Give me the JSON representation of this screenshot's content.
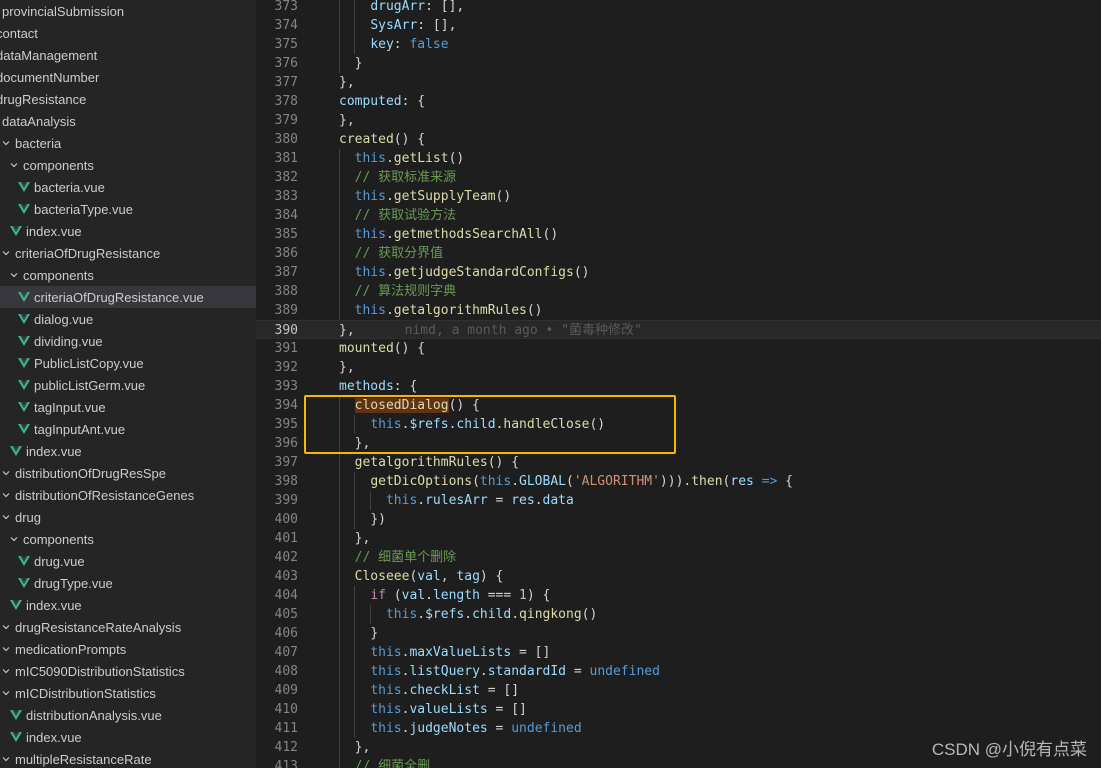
{
  "explorer": {
    "items": [
      {
        "label": "provincialSubmission",
        "level": 0,
        "kind": "folder",
        "chev": false
      },
      {
        "label": "contact",
        "level": -1,
        "kind": "folder",
        "chev": false
      },
      {
        "label": "dataManagement",
        "level": -1,
        "kind": "folder",
        "chev": false
      },
      {
        "label": "documentNumber",
        "level": -1,
        "kind": "folder",
        "chev": false
      },
      {
        "label": "drugResistance",
        "level": -1,
        "kind": "folder",
        "chev": false
      },
      {
        "label": "dataAnalysis",
        "level": 0,
        "kind": "folder",
        "chev": false
      },
      {
        "label": "bacteria",
        "level": 0,
        "kind": "folder",
        "chev": true
      },
      {
        "label": "components",
        "level": 1,
        "kind": "folder",
        "chev": true
      },
      {
        "label": "bacteria.vue",
        "level": 2,
        "kind": "vue"
      },
      {
        "label": "bacteriaType.vue",
        "level": 2,
        "kind": "vue"
      },
      {
        "label": "index.vue",
        "level": 1,
        "kind": "vue"
      },
      {
        "label": "criteriaOfDrugResistance",
        "level": 0,
        "kind": "folder",
        "chev": true
      },
      {
        "label": "components",
        "level": 1,
        "kind": "folder",
        "chev": true
      },
      {
        "label": "criteriaOfDrugResistance.vue",
        "level": 2,
        "kind": "vue",
        "selected": true
      },
      {
        "label": "dialog.vue",
        "level": 2,
        "kind": "vue"
      },
      {
        "label": "dividing.vue",
        "level": 2,
        "kind": "vue"
      },
      {
        "label": "PublicListCopy.vue",
        "level": 2,
        "kind": "vue"
      },
      {
        "label": "publicListGerm.vue",
        "level": 2,
        "kind": "vue"
      },
      {
        "label": "tagInput.vue",
        "level": 2,
        "kind": "vue"
      },
      {
        "label": "tagInputAnt.vue",
        "level": 2,
        "kind": "vue"
      },
      {
        "label": "index.vue",
        "level": 1,
        "kind": "vue"
      },
      {
        "label": "distributionOfDrugResSpe",
        "level": 0,
        "kind": "folder",
        "chev": true
      },
      {
        "label": "distributionOfResistanceGenes",
        "level": 0,
        "kind": "folder",
        "chev": true
      },
      {
        "label": "drug",
        "level": 0,
        "kind": "folder",
        "chev": true
      },
      {
        "label": "components",
        "level": 1,
        "kind": "folder",
        "chev": true
      },
      {
        "label": "drug.vue",
        "level": 2,
        "kind": "vue"
      },
      {
        "label": "drugType.vue",
        "level": 2,
        "kind": "vue"
      },
      {
        "label": "index.vue",
        "level": 1,
        "kind": "vue"
      },
      {
        "label": "drugResistanceRateAnalysis",
        "level": 0,
        "kind": "folder",
        "chev": true
      },
      {
        "label": "medicationPrompts",
        "level": 0,
        "kind": "folder",
        "chev": true
      },
      {
        "label": "mIC5090DistributionStatistics",
        "level": 0,
        "kind": "folder",
        "chev": true
      },
      {
        "label": "mICDistributionStatistics",
        "level": 0,
        "kind": "folder",
        "chev": true
      },
      {
        "label": "distributionAnalysis.vue",
        "level": 1,
        "kind": "vue"
      },
      {
        "label": "index.vue",
        "level": 1,
        "kind": "vue"
      },
      {
        "label": "multipleResistanceRate",
        "level": 0,
        "kind": "folder",
        "chev": true
      }
    ]
  },
  "editor": {
    "current_line": 390,
    "blame_text": "nimd, a month ago • \"菌毒种修改\"",
    "lines": [
      {
        "n": 373,
        "i": 4,
        "t": [
          [
            "prop",
            "drugArr"
          ],
          [
            "punc",
            ": [],"
          ]
        ]
      },
      {
        "n": 374,
        "i": 4,
        "t": [
          [
            "prop",
            "SysArr"
          ],
          [
            "punc",
            ": [],"
          ]
        ]
      },
      {
        "n": 375,
        "i": 4,
        "t": [
          [
            "prop",
            "key"
          ],
          [
            "punc",
            ": "
          ],
          [
            "kw",
            "false"
          ]
        ]
      },
      {
        "n": 376,
        "i": 3,
        "t": [
          [
            "punc",
            "}"
          ]
        ]
      },
      {
        "n": 377,
        "i": 2,
        "t": [
          [
            "punc",
            "},"
          ]
        ]
      },
      {
        "n": 378,
        "i": 2,
        "t": [
          [
            "prop",
            "computed"
          ],
          [
            "punc",
            ": {"
          ]
        ]
      },
      {
        "n": 379,
        "i": 2,
        "t": [
          [
            "punc",
            "},"
          ]
        ]
      },
      {
        "n": 380,
        "i": 2,
        "t": [
          [
            "fn",
            "created"
          ],
          [
            "punc",
            "() {"
          ]
        ]
      },
      {
        "n": 381,
        "i": 3,
        "t": [
          [
            "kw",
            "this"
          ],
          [
            "punc",
            "."
          ],
          [
            "fn",
            "getList"
          ],
          [
            "punc",
            "()"
          ]
        ]
      },
      {
        "n": 382,
        "i": 3,
        "t": [
          [
            "cmt",
            "// 获取标准来源"
          ]
        ]
      },
      {
        "n": 383,
        "i": 3,
        "t": [
          [
            "kw",
            "this"
          ],
          [
            "punc",
            "."
          ],
          [
            "fn",
            "getSupplyTeam"
          ],
          [
            "punc",
            "()"
          ]
        ]
      },
      {
        "n": 384,
        "i": 3,
        "t": [
          [
            "cmt",
            "// 获取试验方法"
          ]
        ]
      },
      {
        "n": 385,
        "i": 3,
        "t": [
          [
            "kw",
            "this"
          ],
          [
            "punc",
            "."
          ],
          [
            "fn",
            "getmethodsSearchAll"
          ],
          [
            "punc",
            "()"
          ]
        ]
      },
      {
        "n": 386,
        "i": 3,
        "t": [
          [
            "cmt",
            "// 获取分界值"
          ]
        ]
      },
      {
        "n": 387,
        "i": 3,
        "t": [
          [
            "kw",
            "this"
          ],
          [
            "punc",
            "."
          ],
          [
            "fn",
            "getjudgeStandardConfigs"
          ],
          [
            "punc",
            "()"
          ]
        ]
      },
      {
        "n": 388,
        "i": 3,
        "t": [
          [
            "cmt",
            "// 算法规则字典"
          ]
        ]
      },
      {
        "n": 389,
        "i": 3,
        "t": [
          [
            "kw",
            "this"
          ],
          [
            "punc",
            "."
          ],
          [
            "fn",
            "getalgorithmRules"
          ],
          [
            "punc",
            "()"
          ]
        ]
      },
      {
        "n": 390,
        "i": 2,
        "t": [
          [
            "punc",
            "},"
          ]
        ],
        "blame": true
      },
      {
        "n": 391,
        "i": 2,
        "t": [
          [
            "fn",
            "mounted"
          ],
          [
            "punc",
            "() {"
          ]
        ]
      },
      {
        "n": 392,
        "i": 2,
        "t": [
          [
            "punc",
            "},"
          ]
        ]
      },
      {
        "n": 393,
        "i": 2,
        "t": [
          [
            "prop",
            "methods"
          ],
          [
            "punc",
            ": {"
          ]
        ]
      },
      {
        "n": 394,
        "i": 3,
        "t": [
          [
            "match",
            "closedDialog"
          ],
          [
            "punc",
            "() {"
          ]
        ]
      },
      {
        "n": 395,
        "i": 4,
        "t": [
          [
            "kw",
            "this"
          ],
          [
            "punc",
            "."
          ],
          [
            "prop",
            "$refs"
          ],
          [
            "punc",
            "."
          ],
          [
            "prop",
            "child"
          ],
          [
            "punc",
            "."
          ],
          [
            "fn",
            "handleClose"
          ],
          [
            "punc",
            "()"
          ]
        ]
      },
      {
        "n": 396,
        "i": 3,
        "t": [
          [
            "punc",
            "},"
          ]
        ]
      },
      {
        "n": 397,
        "i": 3,
        "t": [
          [
            "fn",
            "getalgorithmRules"
          ],
          [
            "punc",
            "() {"
          ]
        ]
      },
      {
        "n": 398,
        "i": 4,
        "t": [
          [
            "fn",
            "getDicOptions"
          ],
          [
            "punc",
            "("
          ],
          [
            "kw",
            "this"
          ],
          [
            "punc",
            "."
          ],
          [
            "prop",
            "GLOBAL"
          ],
          [
            "punc",
            "("
          ],
          [
            "str",
            "'ALGORITHM'"
          ],
          [
            "punc",
            ")))."
          ],
          [
            "fn",
            "then"
          ],
          [
            "punc",
            "("
          ],
          [
            "prop",
            "res"
          ],
          [
            "punc",
            " "
          ],
          [
            "kw",
            "=>"
          ],
          [
            "punc",
            " {"
          ]
        ]
      },
      {
        "n": 399,
        "i": 5,
        "t": [
          [
            "kw",
            "this"
          ],
          [
            "punc",
            "."
          ],
          [
            "prop",
            "rulesArr"
          ],
          [
            "punc",
            " = "
          ],
          [
            "prop",
            "res"
          ],
          [
            "punc",
            "."
          ],
          [
            "prop",
            "data"
          ]
        ]
      },
      {
        "n": 400,
        "i": 4,
        "t": [
          [
            "punc",
            "})"
          ]
        ]
      },
      {
        "n": 401,
        "i": 3,
        "t": [
          [
            "punc",
            "},"
          ]
        ]
      },
      {
        "n": 402,
        "i": 3,
        "t": [
          [
            "cmt",
            "// 细菌单个删除"
          ]
        ]
      },
      {
        "n": 403,
        "i": 3,
        "t": [
          [
            "fn",
            "Closeee"
          ],
          [
            "punc",
            "("
          ],
          [
            "prop",
            "val"
          ],
          [
            "punc",
            ", "
          ],
          [
            "prop",
            "tag"
          ],
          [
            "punc",
            ") {"
          ]
        ]
      },
      {
        "n": 404,
        "i": 4,
        "t": [
          [
            "ctrl",
            "if"
          ],
          [
            "punc",
            " ("
          ],
          [
            "prop",
            "val"
          ],
          [
            "punc",
            "."
          ],
          [
            "prop",
            "length"
          ],
          [
            "punc",
            " === "
          ],
          [
            "num",
            "1"
          ],
          [
            "punc",
            ") {"
          ]
        ]
      },
      {
        "n": 405,
        "i": 5,
        "t": [
          [
            "kw",
            "this"
          ],
          [
            "punc",
            "."
          ],
          [
            "prop",
            "$refs"
          ],
          [
            "punc",
            "."
          ],
          [
            "prop",
            "child"
          ],
          [
            "punc",
            "."
          ],
          [
            "fn",
            "qingkong"
          ],
          [
            "punc",
            "()"
          ]
        ]
      },
      {
        "n": 406,
        "i": 4,
        "t": [
          [
            "punc",
            "}"
          ]
        ]
      },
      {
        "n": 407,
        "i": 4,
        "t": [
          [
            "kw",
            "this"
          ],
          [
            "punc",
            "."
          ],
          [
            "prop",
            "maxValueLists"
          ],
          [
            "punc",
            " = []"
          ]
        ]
      },
      {
        "n": 408,
        "i": 4,
        "t": [
          [
            "kw",
            "this"
          ],
          [
            "punc",
            "."
          ],
          [
            "prop",
            "listQuery"
          ],
          [
            "punc",
            "."
          ],
          [
            "prop",
            "standardId"
          ],
          [
            "punc",
            " = "
          ],
          [
            "kw",
            "undefined"
          ]
        ]
      },
      {
        "n": 409,
        "i": 4,
        "t": [
          [
            "kw",
            "this"
          ],
          [
            "punc",
            "."
          ],
          [
            "prop",
            "checkList"
          ],
          [
            "punc",
            " = []"
          ]
        ]
      },
      {
        "n": 410,
        "i": 4,
        "t": [
          [
            "kw",
            "this"
          ],
          [
            "punc",
            "."
          ],
          [
            "prop",
            "valueLists"
          ],
          [
            "punc",
            " = []"
          ]
        ]
      },
      {
        "n": 411,
        "i": 4,
        "t": [
          [
            "kw",
            "this"
          ],
          [
            "punc",
            "."
          ],
          [
            "prop",
            "judgeNotes"
          ],
          [
            "punc",
            " = "
          ],
          [
            "kw",
            "undefined"
          ]
        ]
      },
      {
        "n": 412,
        "i": 3,
        "t": [
          [
            "punc",
            "},"
          ]
        ]
      },
      {
        "n": 413,
        "i": 3,
        "t": [
          [
            "cmt",
            "// 细菌全删"
          ]
        ]
      }
    ]
  },
  "watermark": "CSDN @小倪有点菜"
}
